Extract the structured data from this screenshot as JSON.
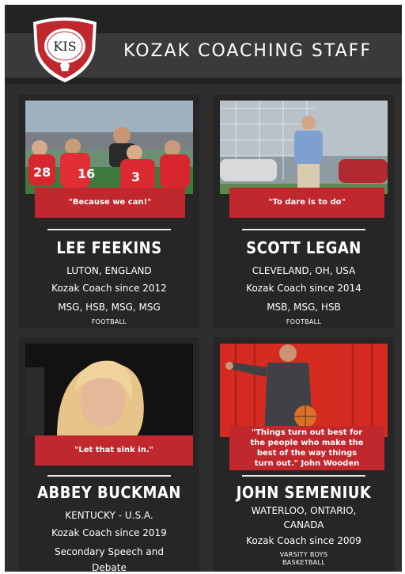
{
  "header": {
    "logo_text": "KIS",
    "title": "KOZAK COACHING STAFF"
  },
  "colors": {
    "background": "#2e2e2f",
    "card": "#262627",
    "accent": "#c0282e",
    "text": "#ffffff"
  },
  "coaches": [
    {
      "quote": "\"Because we can!\"",
      "name": "LEE FEEKINS",
      "location": "LUTON, ENGLAND",
      "since": "Kozak Coach since 2012",
      "teams": "MSG, HSB, MSG, MSG",
      "sport": "FOOTBALL"
    },
    {
      "quote": "\"To dare is to do\"",
      "name": "SCOTT LEGAN",
      "location": "CLEVELAND, OH, USA",
      "since": "Kozak Coach since 2014",
      "teams": "MSB, MSG, HSB",
      "sport": "FOOTBALL"
    },
    {
      "quote": "\"Let that sink in.\"",
      "name": "ABBEY BUCKMAN",
      "location": "KENTUCKY - U.S.A.",
      "since": "Kozak Coach since 2019",
      "teams_line1": "Secondary Speech and",
      "teams_line2": "Debate"
    },
    {
      "quote_line1": "\"Things turn out best for",
      "quote_line2": "the people who make the",
      "quote_line3": "best of the way things",
      "quote_line4": "turn out.\" John Wooden",
      "name": "JOHN SEMENIUK",
      "location_line1": "WATERLOO, ONTARIO,",
      "location_line2": "CANADA",
      "since": "Kozak Coach since 2009",
      "sport_line1": "VARSITY BOYS",
      "sport_line2": "BASKETBALL"
    }
  ]
}
